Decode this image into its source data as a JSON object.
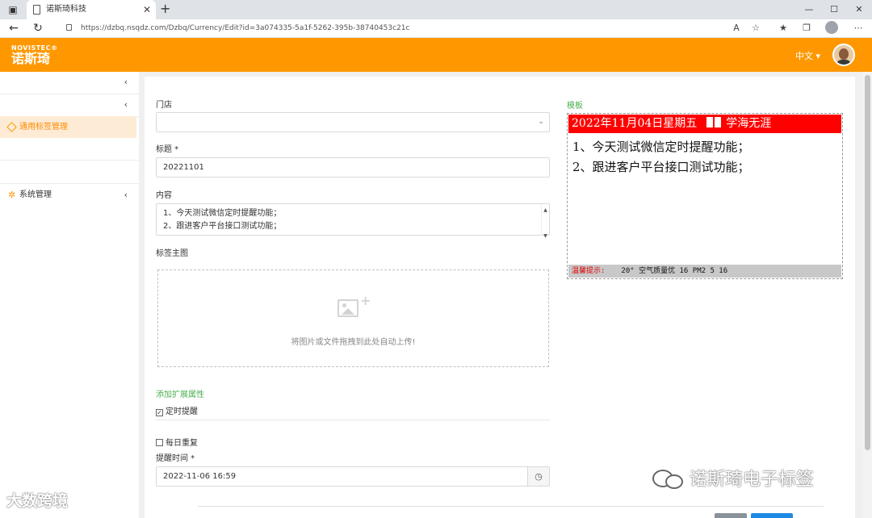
{
  "browser": {
    "tab_title": "诺斯琦科技",
    "tab_close": "✕",
    "new_tab": "+",
    "url": "https://dzbq.nsqdz.com/Dzbq/Currency/Edit?id=3a074335-5a1f-5262-395b-38740453c21c",
    "window_controls": {
      "minimize": "—",
      "maximize": "☐",
      "close": "✕"
    }
  },
  "header": {
    "logo_en": "NOVISTEC®",
    "logo_cn": "诺斯琦",
    "language": "中文 ▾",
    "brand_color": "#ff9800"
  },
  "sidebar": {
    "collapse_chevron": "‹",
    "items": [
      {
        "label": "通用标签管理",
        "icon": "tag-icon",
        "active": true
      },
      {
        "label": "系统管理",
        "icon": "gear-icon",
        "active": false
      }
    ]
  },
  "form": {
    "store_label": "门店",
    "store_value": "",
    "title_label": "标题 *",
    "title_value": "20221101",
    "content_label": "内容",
    "content_lines": [
      "1、今天测试微信定时提醒功能；",
      "2、跟进客户平台接口测试功能；"
    ],
    "image_label": "标签主图",
    "upload_hint": "将图片或文件拖拽到此处自动上传!",
    "ext_title": "添加扩展属性",
    "timed_reminder_label": "定时提醒",
    "timed_reminder_checked": true,
    "daily_repeat_label": "每日重复",
    "daily_repeat_checked": false,
    "reminder_time_label": "提醒时间 *",
    "reminder_time_value": "2022-11-06 16:59"
  },
  "preview": {
    "template_label": "模板",
    "header_date": "2022年11月04日星期五",
    "header_motto": "学海无涯",
    "lines": [
      "1、今天测试微信定时提醒功能；",
      "2、跟进客户平台接口测试功能；"
    ],
    "footer_warm": "温馨提示:",
    "footer_info": "20° 空气质量优 16 PM2 5 16",
    "header_color": "#ff0000"
  },
  "watermarks": {
    "left": "大数跨境",
    "right": "诺斯琦电子标签"
  }
}
